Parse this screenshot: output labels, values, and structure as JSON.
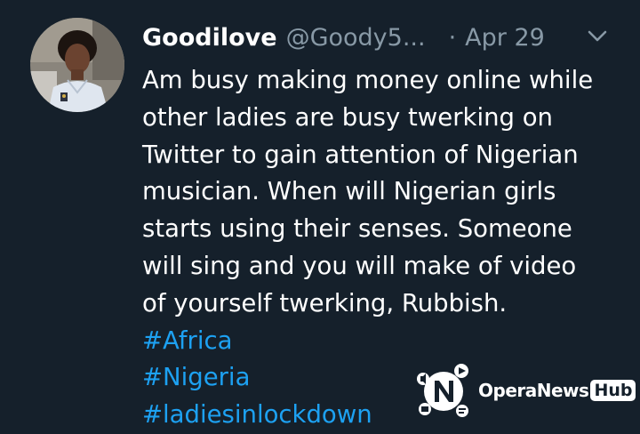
{
  "tweet": {
    "display_name": "Goodilove",
    "handle": "@Goody5...",
    "separator": "·",
    "date": "Apr 29",
    "text_lines": [
      "Am busy making money online while",
      "other ladies are busy twerking on",
      "Twitter to gain attention of Nigerian",
      "musician. When will Nigerian girls",
      "starts using their senses. Someone",
      "will sing and you will make of video",
      "of yourself twerking, Rubbish."
    ],
    "hashtags": [
      "#Africa",
      "#Nigeria",
      "#ladiesinlockdown"
    ],
    "menu_icon": "chevron-down-icon"
  },
  "watermark": {
    "brand": "OperaNews",
    "badge": "Hub"
  },
  "colors": {
    "background": "#15202b",
    "text": "#ffffff",
    "secondary_text": "#8899a6",
    "link": "#1da1f2"
  }
}
